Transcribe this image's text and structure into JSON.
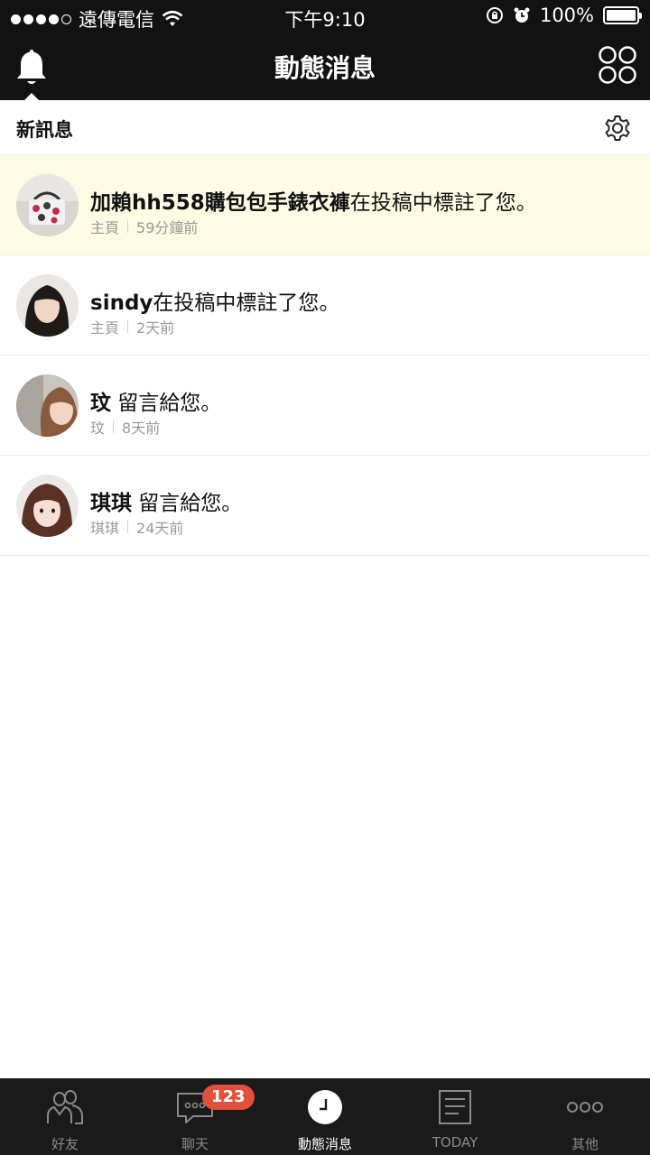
{
  "status_bar": {
    "carrier": "遠傳電信",
    "time": "下午9:10",
    "battery": "100%"
  },
  "header": {
    "title": "動態消息"
  },
  "section": {
    "label": "新訊息"
  },
  "notifications": [
    {
      "name": "加賴hh558購包包手錶衣褲",
      "action": "在投稿中標註了您。",
      "source": "主頁",
      "time": "59分鐘前",
      "unread": true
    },
    {
      "name": "sindy",
      "action": "在投稿中標註了您。",
      "source": "主頁",
      "time": "2天前",
      "unread": false
    },
    {
      "name": "玟",
      "action": " 留言給您。",
      "source": "玟",
      "time": "8天前",
      "unread": false
    },
    {
      "name": "琪琪",
      "action": " 留言給您。",
      "source": "琪琪",
      "time": "24天前",
      "unread": false
    }
  ],
  "tabs": [
    {
      "label": "好友",
      "icon": "friends-icon"
    },
    {
      "label": "聊天",
      "icon": "chat-icon",
      "badge": "123"
    },
    {
      "label": "動態消息",
      "icon": "timeline-clock-icon",
      "active": true
    },
    {
      "label": "TODAY",
      "icon": "today-news-icon"
    },
    {
      "label": "其他",
      "icon": "more-icon"
    }
  ],
  "colors": {
    "bar_bg": "#121212",
    "unread_bg": "#fdfbe3",
    "badge": "#e0503a"
  }
}
